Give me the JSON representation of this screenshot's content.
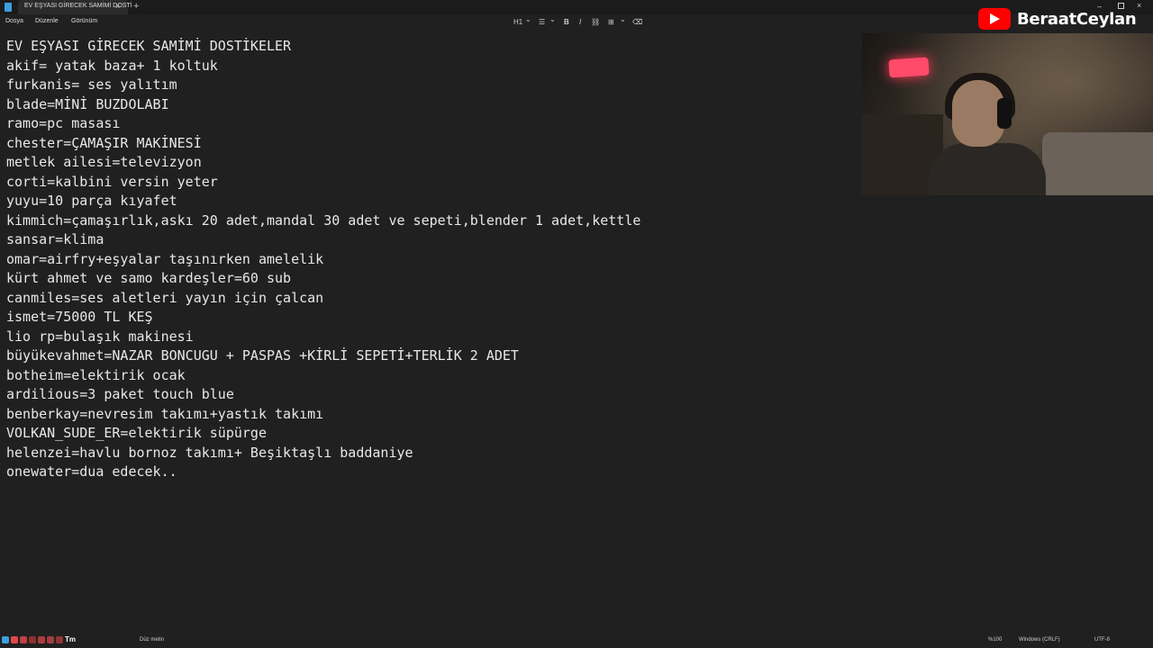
{
  "window": {
    "tab_title": "EV EŞYASI GİRECEK SAMİMİ DOSTİ",
    "tab_close": "×",
    "new_tab": "+",
    "controls": {
      "minimize": "–",
      "close": "×"
    }
  },
  "menu": {
    "items": [
      "Dosya",
      "Düzenle",
      "Görünüm"
    ]
  },
  "toolbar": {
    "heading": "H1",
    "heading_chevron": "⌄",
    "list": "☰",
    "list_chevron": "⌄",
    "bold": "B",
    "italic": "I",
    "link": "⛓",
    "table": "⊞",
    "table_chevron": "⌄",
    "clear": "⌫"
  },
  "brand": {
    "name": "BeraatCeylan",
    "accent": "#ff0000"
  },
  "document": {
    "lines": [
      "EV EŞYASI GİRECEK SAMİMİ DOSTİKELER",
      "akif= yatak baza+ 1 koltuk",
      "furkanis= ses yalıtım",
      "blade=MİNİ BUZDOLABI",
      "ramo=pc masası",
      "chester=ÇAMAŞIR MAKİNESİ",
      "metlek ailesi=televizyon",
      "corti=kalbini versin yeter",
      "yuyu=10 parça kıyafet",
      "kimmich=çamaşırlık,askı 20 adet,mandal 30 adet ve sepeti,blender 1 adet,kettle",
      "sansar=klima",
      "omar=airfry+eşyalar taşınırken amelelik",
      "kürt ahmet ve samo kardeşler=60 sub",
      "canmiles=ses aletleri yayın için çalcan",
      "ismet=75000 TL KEŞ",
      "lio rp=bulaşık makinesi",
      "büyükevahmet=NAZAR BONCUGU + PASPAS +KİRLİ SEPETİ+TERLİK 2 ADET",
      "botheim=elektirik ocak",
      "ardilious=3 paket touch blue",
      "benberkay=nevresim takımı+yastık takımı",
      "VOLKAN_SUDE_ER=elektirik süpürge",
      "helenzei=havlu bornoz takımı+ Beşiktaşlı baddaniye",
      "onewater=dua edecek.."
    ]
  },
  "status": {
    "taskbar_text": "Tm",
    "format": "Düz metin",
    "zoom": "%100",
    "line_ending": "Windows (CRLF)",
    "encoding": "UTF-8"
  }
}
